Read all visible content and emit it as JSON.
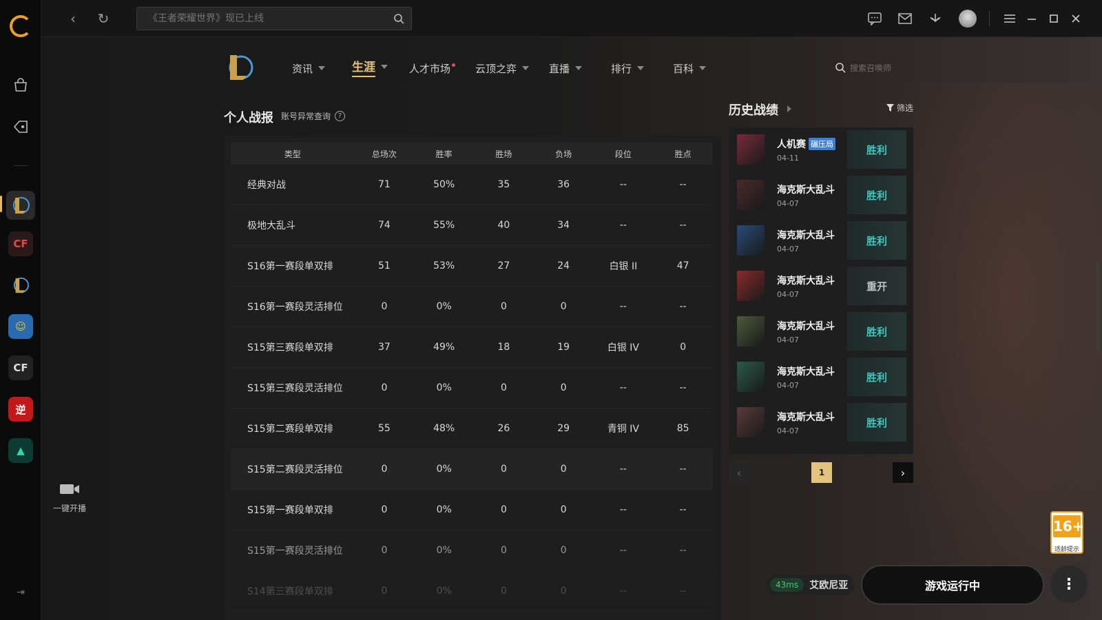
{
  "app": {
    "search_placeholder": "《王者荣耀世界》现已上线",
    "live_label": "一键开播"
  },
  "nav": [
    {
      "label": "资讯"
    },
    {
      "label": "生涯"
    },
    {
      "label": "人才市场"
    },
    {
      "label": "云顶之弈"
    },
    {
      "label": "直播"
    },
    {
      "label": "排行"
    },
    {
      "label": "百科"
    }
  ],
  "summoner_search_placeholder": "搜索召唤师",
  "stats": {
    "title": "个人战报",
    "anomaly_link": "账号异常查询",
    "help": "?",
    "headers": [
      "类型",
      "总场次",
      "胜率",
      "胜场",
      "负场",
      "段位",
      "胜点"
    ],
    "rows": [
      [
        "经典对战",
        "71",
        "50%",
        "35",
        "36",
        "--",
        "--"
      ],
      [
        "极地大乱斗",
        "74",
        "55%",
        "40",
        "34",
        "--",
        "--"
      ],
      [
        "S16第一赛段单双排",
        "51",
        "53%",
        "27",
        "24",
        "白银 II",
        "47"
      ],
      [
        "S16第一赛段灵活排位",
        "0",
        "0%",
        "0",
        "0",
        "--",
        "--"
      ],
      [
        "S15第三赛段单双排",
        "37",
        "49%",
        "18",
        "19",
        "白银 IV",
        "0"
      ],
      [
        "S15第三赛段灵活排位",
        "0",
        "0%",
        "0",
        "0",
        "--",
        "--"
      ],
      [
        "S15第二赛段单双排",
        "55",
        "48%",
        "26",
        "29",
        "青铜 IV",
        "85"
      ],
      [
        "S15第二赛段灵活排位",
        "0",
        "0%",
        "0",
        "0",
        "--",
        "--"
      ],
      [
        "S15第一赛段单双排",
        "0",
        "0%",
        "0",
        "0",
        "--",
        "--"
      ],
      [
        "S15第一赛段灵活排位",
        "0",
        "0%",
        "0",
        "0",
        "--",
        "--"
      ],
      [
        "S14第三赛段单双排",
        "0",
        "0%",
        "0",
        "0",
        "--",
        "--"
      ]
    ]
  },
  "history": {
    "title": "历史战绩",
    "filter_label": "筛选",
    "items": [
      {
        "mode": "人机赛",
        "badge": "碾压局",
        "date": "04-11",
        "result": "胜利",
        "color": "#7a2a3a"
      },
      {
        "mode": "海克斯大乱斗",
        "badge": "",
        "date": "04-07",
        "result": "胜利",
        "color": "#4a2a2a"
      },
      {
        "mode": "海克斯大乱斗",
        "badge": "",
        "date": "04-07",
        "result": "胜利",
        "color": "#2a4a7a"
      },
      {
        "mode": "海克斯大乱斗",
        "badge": "",
        "date": "04-07",
        "result": "重开",
        "color": "#8a2a2a"
      },
      {
        "mode": "海克斯大乱斗",
        "badge": "",
        "date": "04-07",
        "result": "胜利",
        "color": "#4a5a3a"
      },
      {
        "mode": "海克斯大乱斗",
        "badge": "",
        "date": "04-07",
        "result": "胜利",
        "color": "#2a5a4a"
      },
      {
        "mode": "海克斯大乱斗",
        "badge": "",
        "date": "04-07",
        "result": "胜利",
        "color": "#5a3a3a"
      }
    ],
    "page": "1"
  },
  "status": {
    "ping": "43ms",
    "region": "艾欧尼亚",
    "run_label": "游戏运行中",
    "more": "⋮"
  },
  "age_rating": {
    "number": "16+",
    "caption": "适龄提示"
  }
}
